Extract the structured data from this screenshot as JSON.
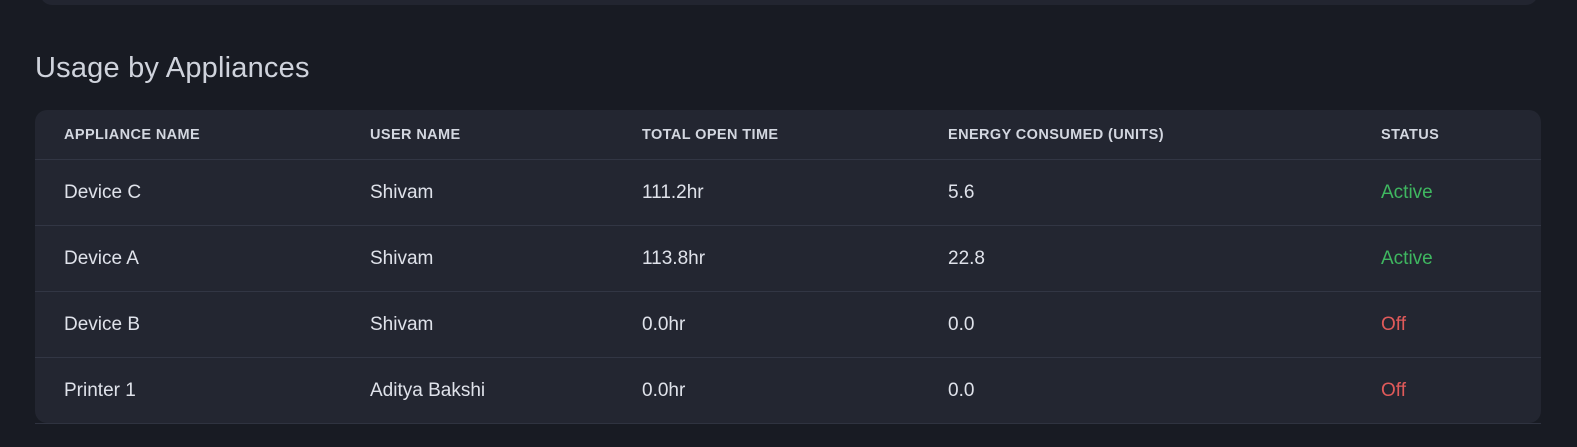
{
  "section_title": "Usage by Appliances",
  "table": {
    "headers": [
      "APPLIANCE NAME",
      "USER NAME",
      "TOTAL OPEN TIME",
      "ENERGY CONSUMED (UNITS)",
      "STATUS"
    ],
    "rows": [
      {
        "appliance": "Device C",
        "user": "Shivam",
        "open_time": "111.2hr",
        "energy": "5.6",
        "status": "Active"
      },
      {
        "appliance": "Device A",
        "user": "Shivam",
        "open_time": "113.8hr",
        "energy": "22.8",
        "status": "Active"
      },
      {
        "appliance": "Device B",
        "user": "Shivam",
        "open_time": "0.0hr",
        "energy": "0.0",
        "status": "Off"
      },
      {
        "appliance": "Printer 1",
        "user": "Aditya Bakshi",
        "open_time": "0.0hr",
        "energy": "0.0",
        "status": "Off"
      }
    ]
  },
  "colors": {
    "background": "#181b23",
    "card": "#232631",
    "status_active": "#3fb760",
    "status_off": "#e05a5a"
  }
}
